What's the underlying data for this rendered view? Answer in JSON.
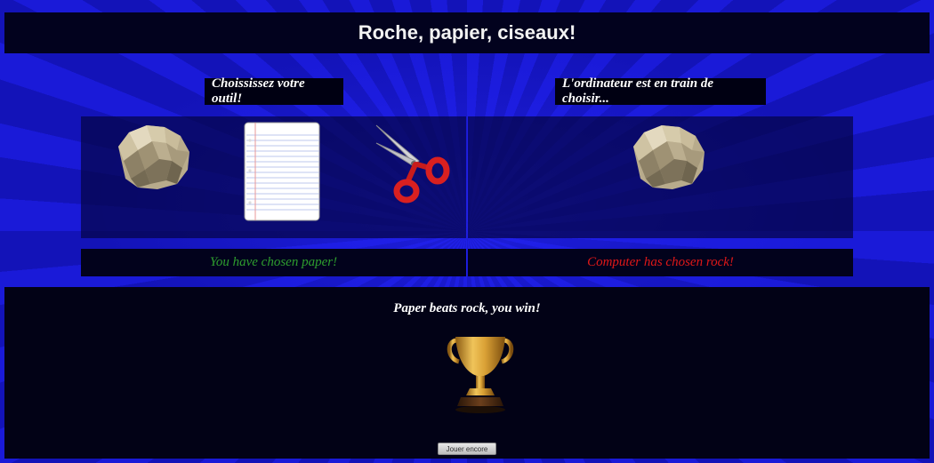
{
  "header": {
    "title": "Roche, papier, ciseaux!"
  },
  "player": {
    "prompt": "Choississez votre outil!",
    "choice_message": "You have chosen paper!",
    "choice_color": "#2e9e2e",
    "tools": [
      {
        "icon": "rock-icon"
      },
      {
        "icon": "paper-icon"
      },
      {
        "icon": "scissors-icon"
      }
    ]
  },
  "computer": {
    "prompt": "L'ordinateur est en train de choisir...",
    "choice_message": "Computer has chosen rock!",
    "choice_color": "#e01818",
    "choice_icon": "rock-icon"
  },
  "result": {
    "message": "Paper beats rock, you win!",
    "icon": "trophy-icon",
    "replay_label": "Jouer encore"
  }
}
